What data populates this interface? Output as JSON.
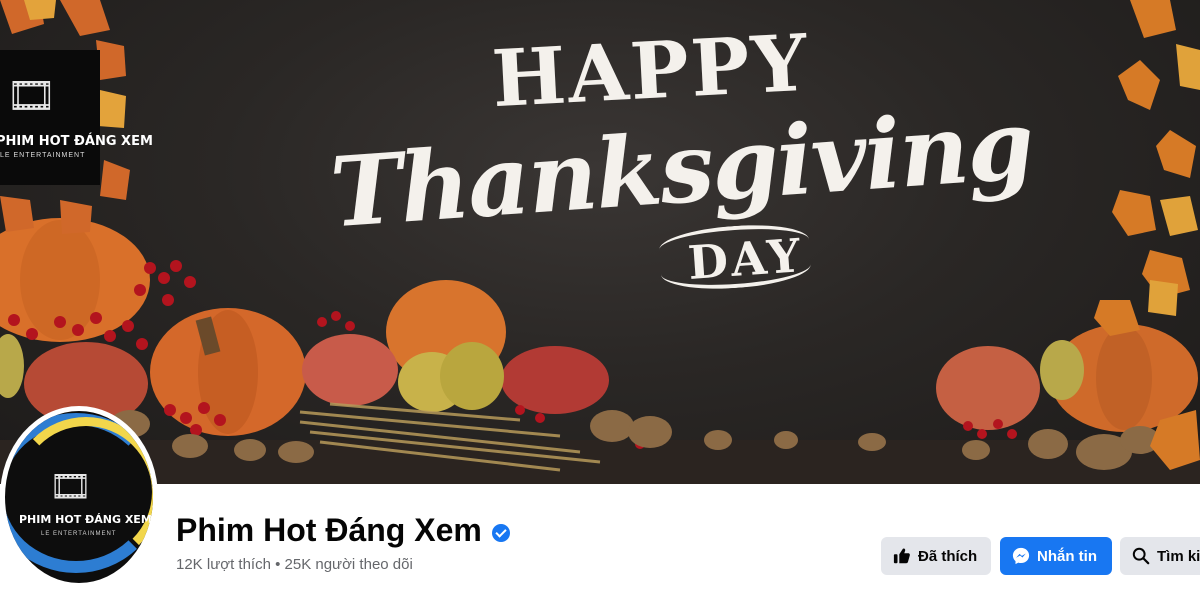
{
  "cover": {
    "line1": "HAPPY",
    "line2": "Thanksgiving",
    "line3": "DAY"
  },
  "brand": {
    "name": "PHIM HOT ĐÁNG XEM",
    "tagline": "LE ENTERTAINMENT"
  },
  "page": {
    "name": "Phim Hot Đáng Xem",
    "stats": "12K lượt thích • 25K người theo dõi"
  },
  "actions": {
    "liked_label": "Đã thích",
    "message_label": "Nhắn tin",
    "search_label": "Tìm ki"
  },
  "colors": {
    "primary": "#1877f2",
    "secondary_button": "#e4e6eb",
    "text": "#050505",
    "muted_text": "#65676b"
  },
  "icons": [
    "thumbs-up-icon",
    "messenger-icon",
    "search-icon",
    "verified-badge-icon"
  ]
}
